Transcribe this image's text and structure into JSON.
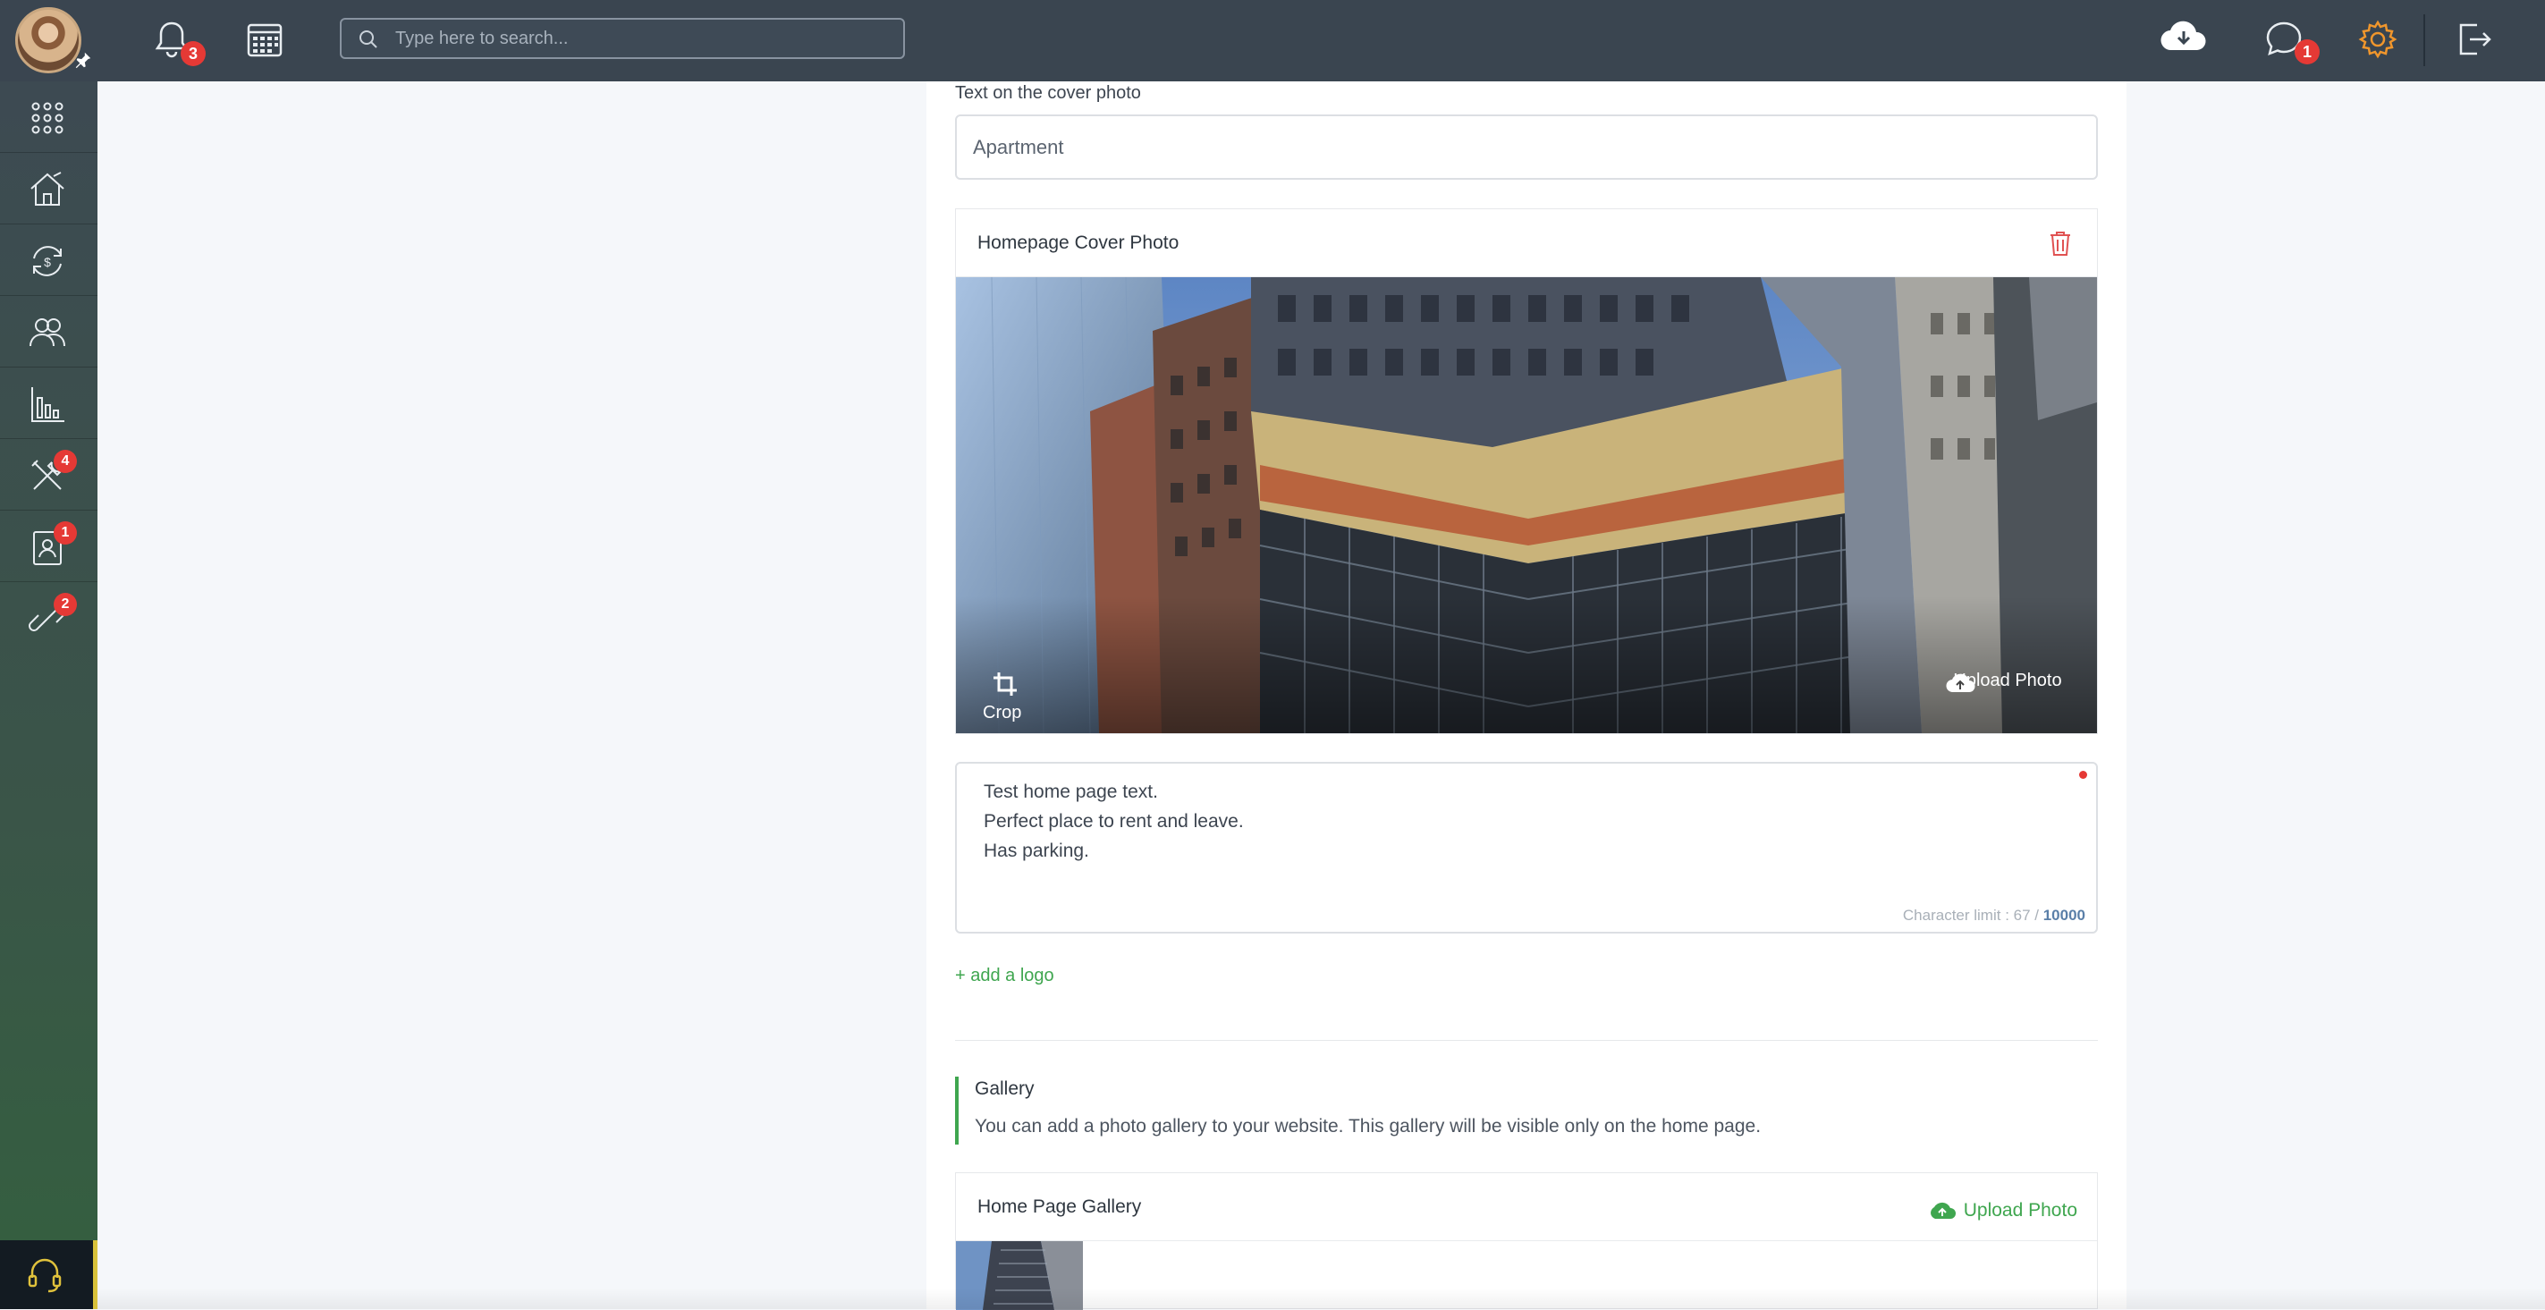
{
  "topbar": {
    "search_placeholder": "Type here to search...",
    "notifications_count": "3",
    "messages_count": "1",
    "accent_color": "#f0962c"
  },
  "sidebar": {
    "items": [
      {
        "icon": "apps-grid-icon"
      },
      {
        "icon": "house-icon"
      },
      {
        "icon": "money-cycle-icon"
      },
      {
        "icon": "people-icon"
      },
      {
        "icon": "bar-chart-icon"
      },
      {
        "icon": "tools-icon",
        "badge": "4"
      },
      {
        "icon": "tenant-badge-icon",
        "badge": "1"
      },
      {
        "icon": "link-icon",
        "badge": "2"
      }
    ],
    "support_icon": "headset-icon"
  },
  "form": {
    "cover_text_label": "Text on the cover photo",
    "cover_text_value": "Apartment",
    "cover_card_title": "Homepage Cover Photo",
    "crop_label": "Crop",
    "upload_photo_label": "Upload Photo",
    "homepage_text_lines": [
      "Test home page text.",
      "Perfect place to rent and leave.",
      "Has parking."
    ],
    "char_limit_prefix": "Character limit : 67 / ",
    "char_limit_max": "10000",
    "add_logo_label": "+ add a logo"
  },
  "gallery": {
    "title": "Gallery",
    "description": "You can add a photo gallery to your website. This gallery will be visible only on the home page.",
    "card_title": "Home Page Gallery",
    "upload_label": "Upload Photo"
  },
  "colors": {
    "topbar": "#3a4550",
    "green_accent": "#3fa64f",
    "badge_red": "#e53935"
  }
}
